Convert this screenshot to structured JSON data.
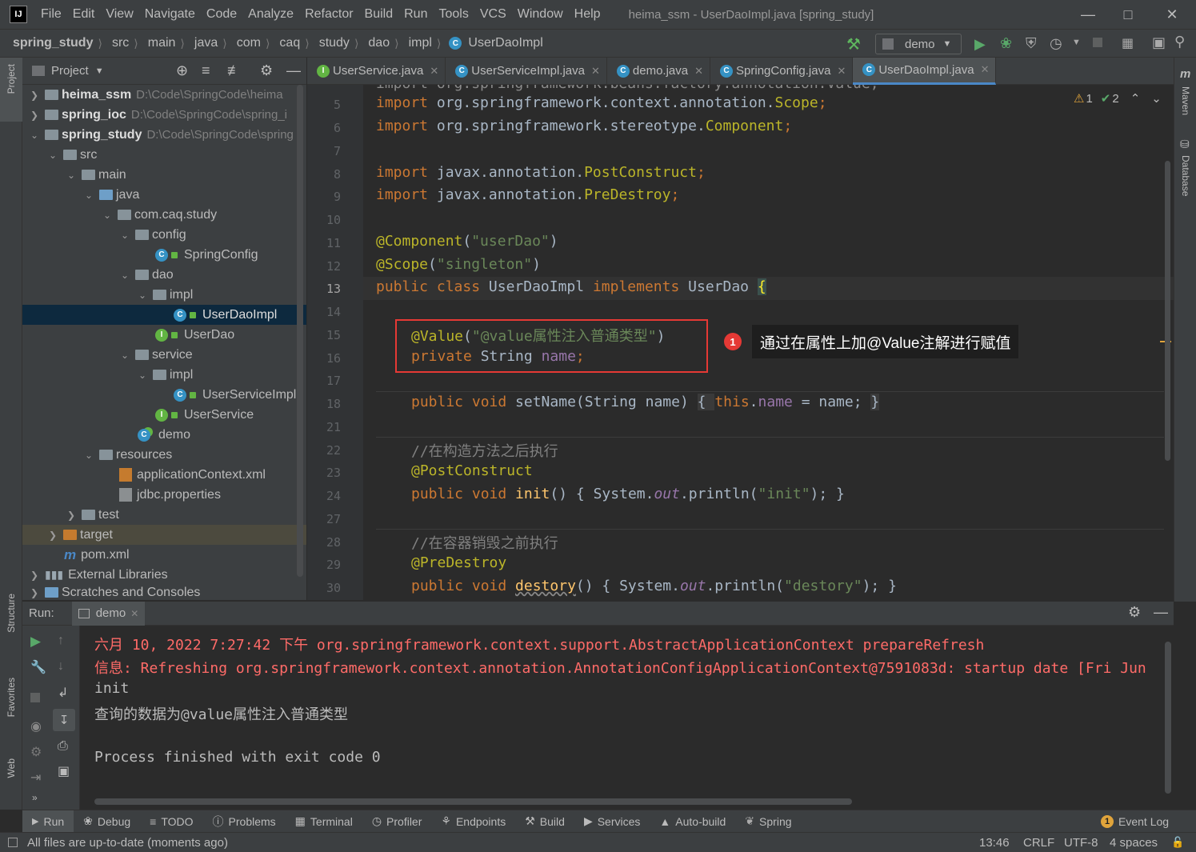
{
  "app": {
    "title": "heima_ssm - UserDaoImpl.java [spring_study]",
    "logo": "IJ"
  },
  "menu": [
    "File",
    "Edit",
    "View",
    "Navigate",
    "Code",
    "Analyze",
    "Refactor",
    "Build",
    "Run",
    "Tools",
    "VCS",
    "Window",
    "Help"
  ],
  "breadcrumb": [
    "spring_study",
    "src",
    "main",
    "java",
    "com",
    "caq",
    "study",
    "dao",
    "impl",
    "UserDaoImpl"
  ],
  "run_config": "demo",
  "project_panel": {
    "title": "Project",
    "tree": [
      {
        "label": "heima_ssm",
        "path": "D:\\Code\\SpringCode\\heima",
        "bold": true
      },
      {
        "label": "spring_ioc",
        "path": "D:\\Code\\SpringCode\\spring_i",
        "bold": true
      },
      {
        "label": "spring_study",
        "path": "D:\\Code\\SpringCode\\spring",
        "bold": true
      },
      {
        "label": "src"
      },
      {
        "label": "main"
      },
      {
        "label": "java"
      },
      {
        "label": "com.caq.study"
      },
      {
        "label": "config"
      },
      {
        "label": "SpringConfig"
      },
      {
        "label": "dao"
      },
      {
        "label": "impl"
      },
      {
        "label": "UserDaoImpl"
      },
      {
        "label": "UserDao"
      },
      {
        "label": "service"
      },
      {
        "label": "impl"
      },
      {
        "label": "UserServiceImpl"
      },
      {
        "label": "UserService"
      },
      {
        "label": "demo"
      },
      {
        "label": "resources"
      },
      {
        "label": "applicationContext.xml"
      },
      {
        "label": "jdbc.properties"
      },
      {
        "label": "test"
      },
      {
        "label": "target"
      },
      {
        "label": "pom.xml"
      },
      {
        "label": "External Libraries"
      },
      {
        "label": "Scratches and Consoles"
      }
    ]
  },
  "tabs": [
    "UserService.java",
    "UserServiceImpl.java",
    "demo.java",
    "SpringConfig.java",
    "UserDaoImpl.java"
  ],
  "inspections": {
    "warnings": "1",
    "ok": "2"
  },
  "line_numbers": [
    "5",
    "6",
    "7",
    "8",
    "9",
    "10",
    "11",
    "12",
    "13",
    "14",
    "15",
    "16",
    "17",
    "18",
    "21",
    "22",
    "23",
    "24",
    "27",
    "28",
    "29",
    "30"
  ],
  "code": {
    "l4": "import org.springframework.beans.factory.annotation.Value;",
    "l5a": "import ",
    "l5b": "org.springframework.context.annotation.",
    "l5c": "Scope",
    "l5d": ";",
    "l6a": "import ",
    "l6b": "org.springframework.stereotype.",
    "l6c": "Component",
    "l6d": ";",
    "l8a": "import ",
    "l8b": "javax.annotation.",
    "l8c": "PostConstruct",
    "l8d": ";",
    "l9a": "import ",
    "l9b": "javax.annotation.",
    "l9c": "PreDestroy",
    "l9d": ";",
    "l11a": "@Component",
    "l11b": "(",
    "l11c": "\"userDao\"",
    "l11d": ")",
    "l12a": "@Scope",
    "l12b": "(",
    "l12c": "\"singleton\"",
    "l12d": ")",
    "l13a": "public class ",
    "l13b": "UserDaoImpl ",
    "l13c": "implements ",
    "l13d": "UserDao ",
    "l13e": "{",
    "l15a": "@Value",
    "l15b": "(",
    "l15c": "\"@value属性注入普通类型\"",
    "l15d": ")",
    "l16a": "private ",
    "l16b": "String ",
    "l16c": "name",
    "l16d": ";",
    "l18a": "public void ",
    "l18b": "setName",
    "l18c": "(String name) ",
    "l18d": "{ ",
    "l18e": "this",
    "l18f": ".",
    "l18g": "name",
    "l18h": " = name; ",
    "l18i": "}",
    "l22": "//在构造方法之后执行",
    "l23": "@PostConstruct",
    "l24a": "public void ",
    "l24b": "init",
    "l24c": "() { System.",
    "l24d": "out",
    "l24e": ".println(",
    "l24f": "\"init\"",
    "l24g": "); }",
    "l28": "//在容器销毁之前执行",
    "l29": "@PreDestroy",
    "l30a": "public void ",
    "l30b": "destory",
    "l30c": "() { System.",
    "l30d": "out",
    "l30e": ".println(",
    "l30f": "\"destory\"",
    "l30g": "); }"
  },
  "callout": {
    "badge": "1",
    "text": "通过在属性上加@Value注解进行赋值"
  },
  "run": {
    "label": "Run:",
    "tab": "demo",
    "lines": [
      "六月 10, 2022 7:27:42 下午 org.springframework.context.support.AbstractApplicationContext prepareRefresh",
      "信息: Refreshing org.springframework.context.annotation.AnnotationConfigApplicationContext@7591083d: startup date [Fri Jun",
      "init",
      "查询的数据为@value属性注入普通类型",
      "",
      "Process finished with exit code 0"
    ]
  },
  "left_strip": [
    "Project",
    "Structure",
    "Favorites",
    "Web"
  ],
  "right_strip": [
    "Maven",
    "Database"
  ],
  "bottom_tabs": [
    "Run",
    "Debug",
    "TODO",
    "Problems",
    "Terminal",
    "Profiler",
    "Endpoints",
    "Build",
    "Services",
    "Auto-build",
    "Spring"
  ],
  "event_log": {
    "count": "1",
    "label": "Event Log"
  },
  "status": {
    "message": "All files are up-to-date (moments ago)",
    "position": "13:46",
    "line_sep": "CRLF",
    "encoding": "UTF-8",
    "indent": "4 spaces"
  },
  "colors": {
    "accent": "#4a88c7",
    "error_text": "#ff6b68",
    "annotation_box": "#e53935"
  }
}
